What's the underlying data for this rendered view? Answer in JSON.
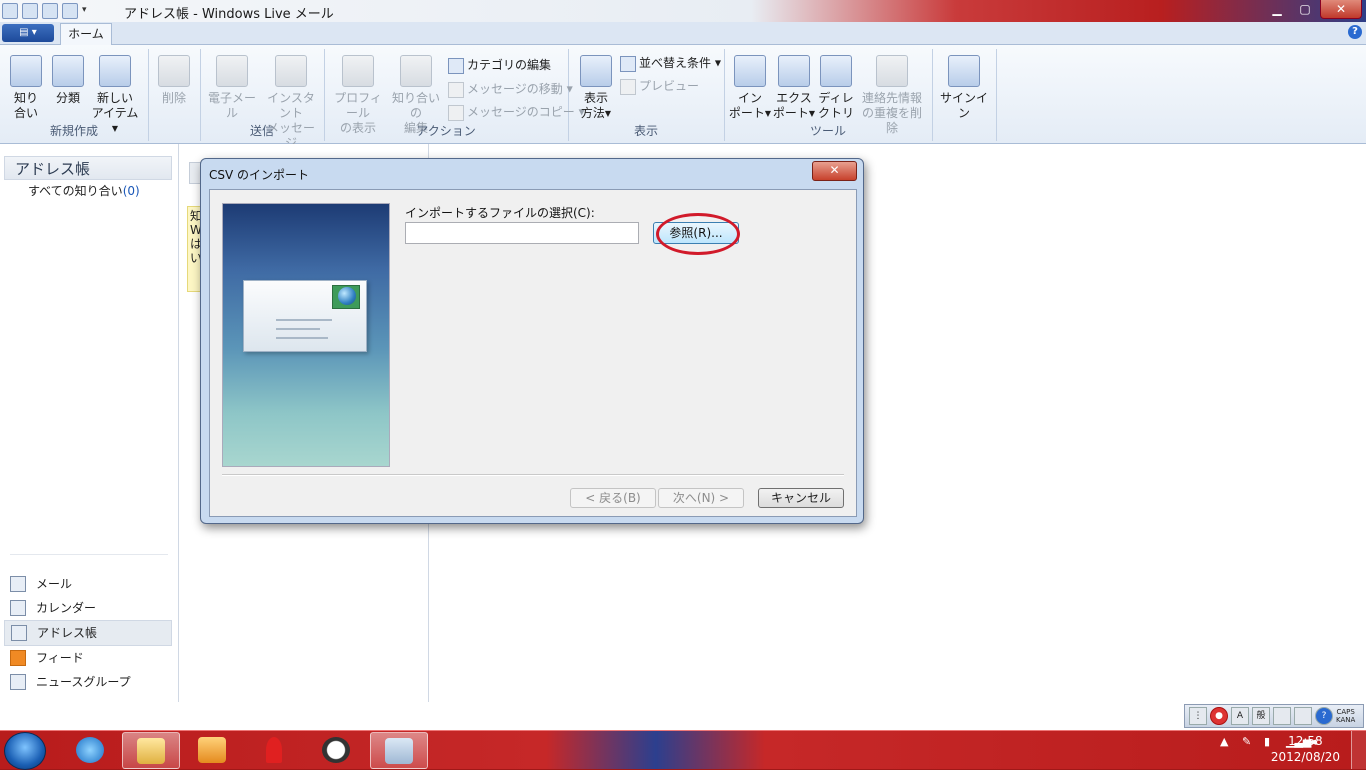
{
  "window": {
    "title": "アドレス帳 - Windows Live メール",
    "min": "▁",
    "max": "▢",
    "close": "✕"
  },
  "ribbon": {
    "tab_home": "ホーム",
    "help": "?",
    "groups": {
      "new": {
        "label": "新規作成",
        "contacts": [
          "知り",
          "合い"
        ],
        "category": "分類",
        "new_item": [
          "新しい",
          "アイテム"
        ]
      },
      "delete": {
        "label": "削除"
      },
      "send": {
        "label": "送信",
        "email": "電子メール",
        "im": [
          "インスタント",
          "メッセージ"
        ]
      },
      "actions": {
        "label": "アクション",
        "profile": [
          "プロフィール",
          "の表示"
        ],
        "edit_contact": [
          "知り合いの",
          "編集"
        ],
        "edit_category": "カテゴリの編集",
        "move_message": "メッセージの移動",
        "copy_message": "メッセージのコピー"
      },
      "view": {
        "label": "表示",
        "display_mode": [
          "表示",
          "方法"
        ],
        "sort": "並べ替え条件",
        "preview": "プレビュー"
      },
      "tools": {
        "label": "ツール",
        "import": [
          "イン",
          "ポート"
        ],
        "export": [
          "エクス",
          "ポート"
        ],
        "directory": [
          "ディレ",
          "クトリ"
        ],
        "dedupe": [
          "連絡先情報",
          "の重複を削除"
        ]
      },
      "signin": {
        "label": "サインイン"
      }
    }
  },
  "left_pane": {
    "header": "アドレス帳",
    "all_contacts": "すべての知り合い",
    "all_contacts_count": "(0)",
    "nav": [
      "メール",
      "カレンダー",
      "アドレス帳",
      "フィード",
      "ニュースグループ"
    ],
    "selected_nav": "アドレス帳"
  },
  "middle": {
    "info_fragment": [
      "知",
      "W",
      "は",
      "い"
    ]
  },
  "dialog": {
    "title": "CSV のインポート",
    "file_label": "インポートするファイルの選択(C):",
    "file_value": "",
    "browse": "参照(R)...",
    "back": "< 戻る(B)",
    "next": "次へ(N) >",
    "cancel": "キャンセル"
  },
  "language_bar": {
    "ime_mode": "A",
    "ime_conv": "般",
    "caps": "CAPS",
    "kana": "KANA"
  },
  "taskbar": {
    "clock_time": "12:58",
    "clock_date": "2012/08/20"
  },
  "colors": {
    "accent": "#1b58b8",
    "highlight_ring": "#d11a2a",
    "taskbar": "#b81c1c"
  }
}
